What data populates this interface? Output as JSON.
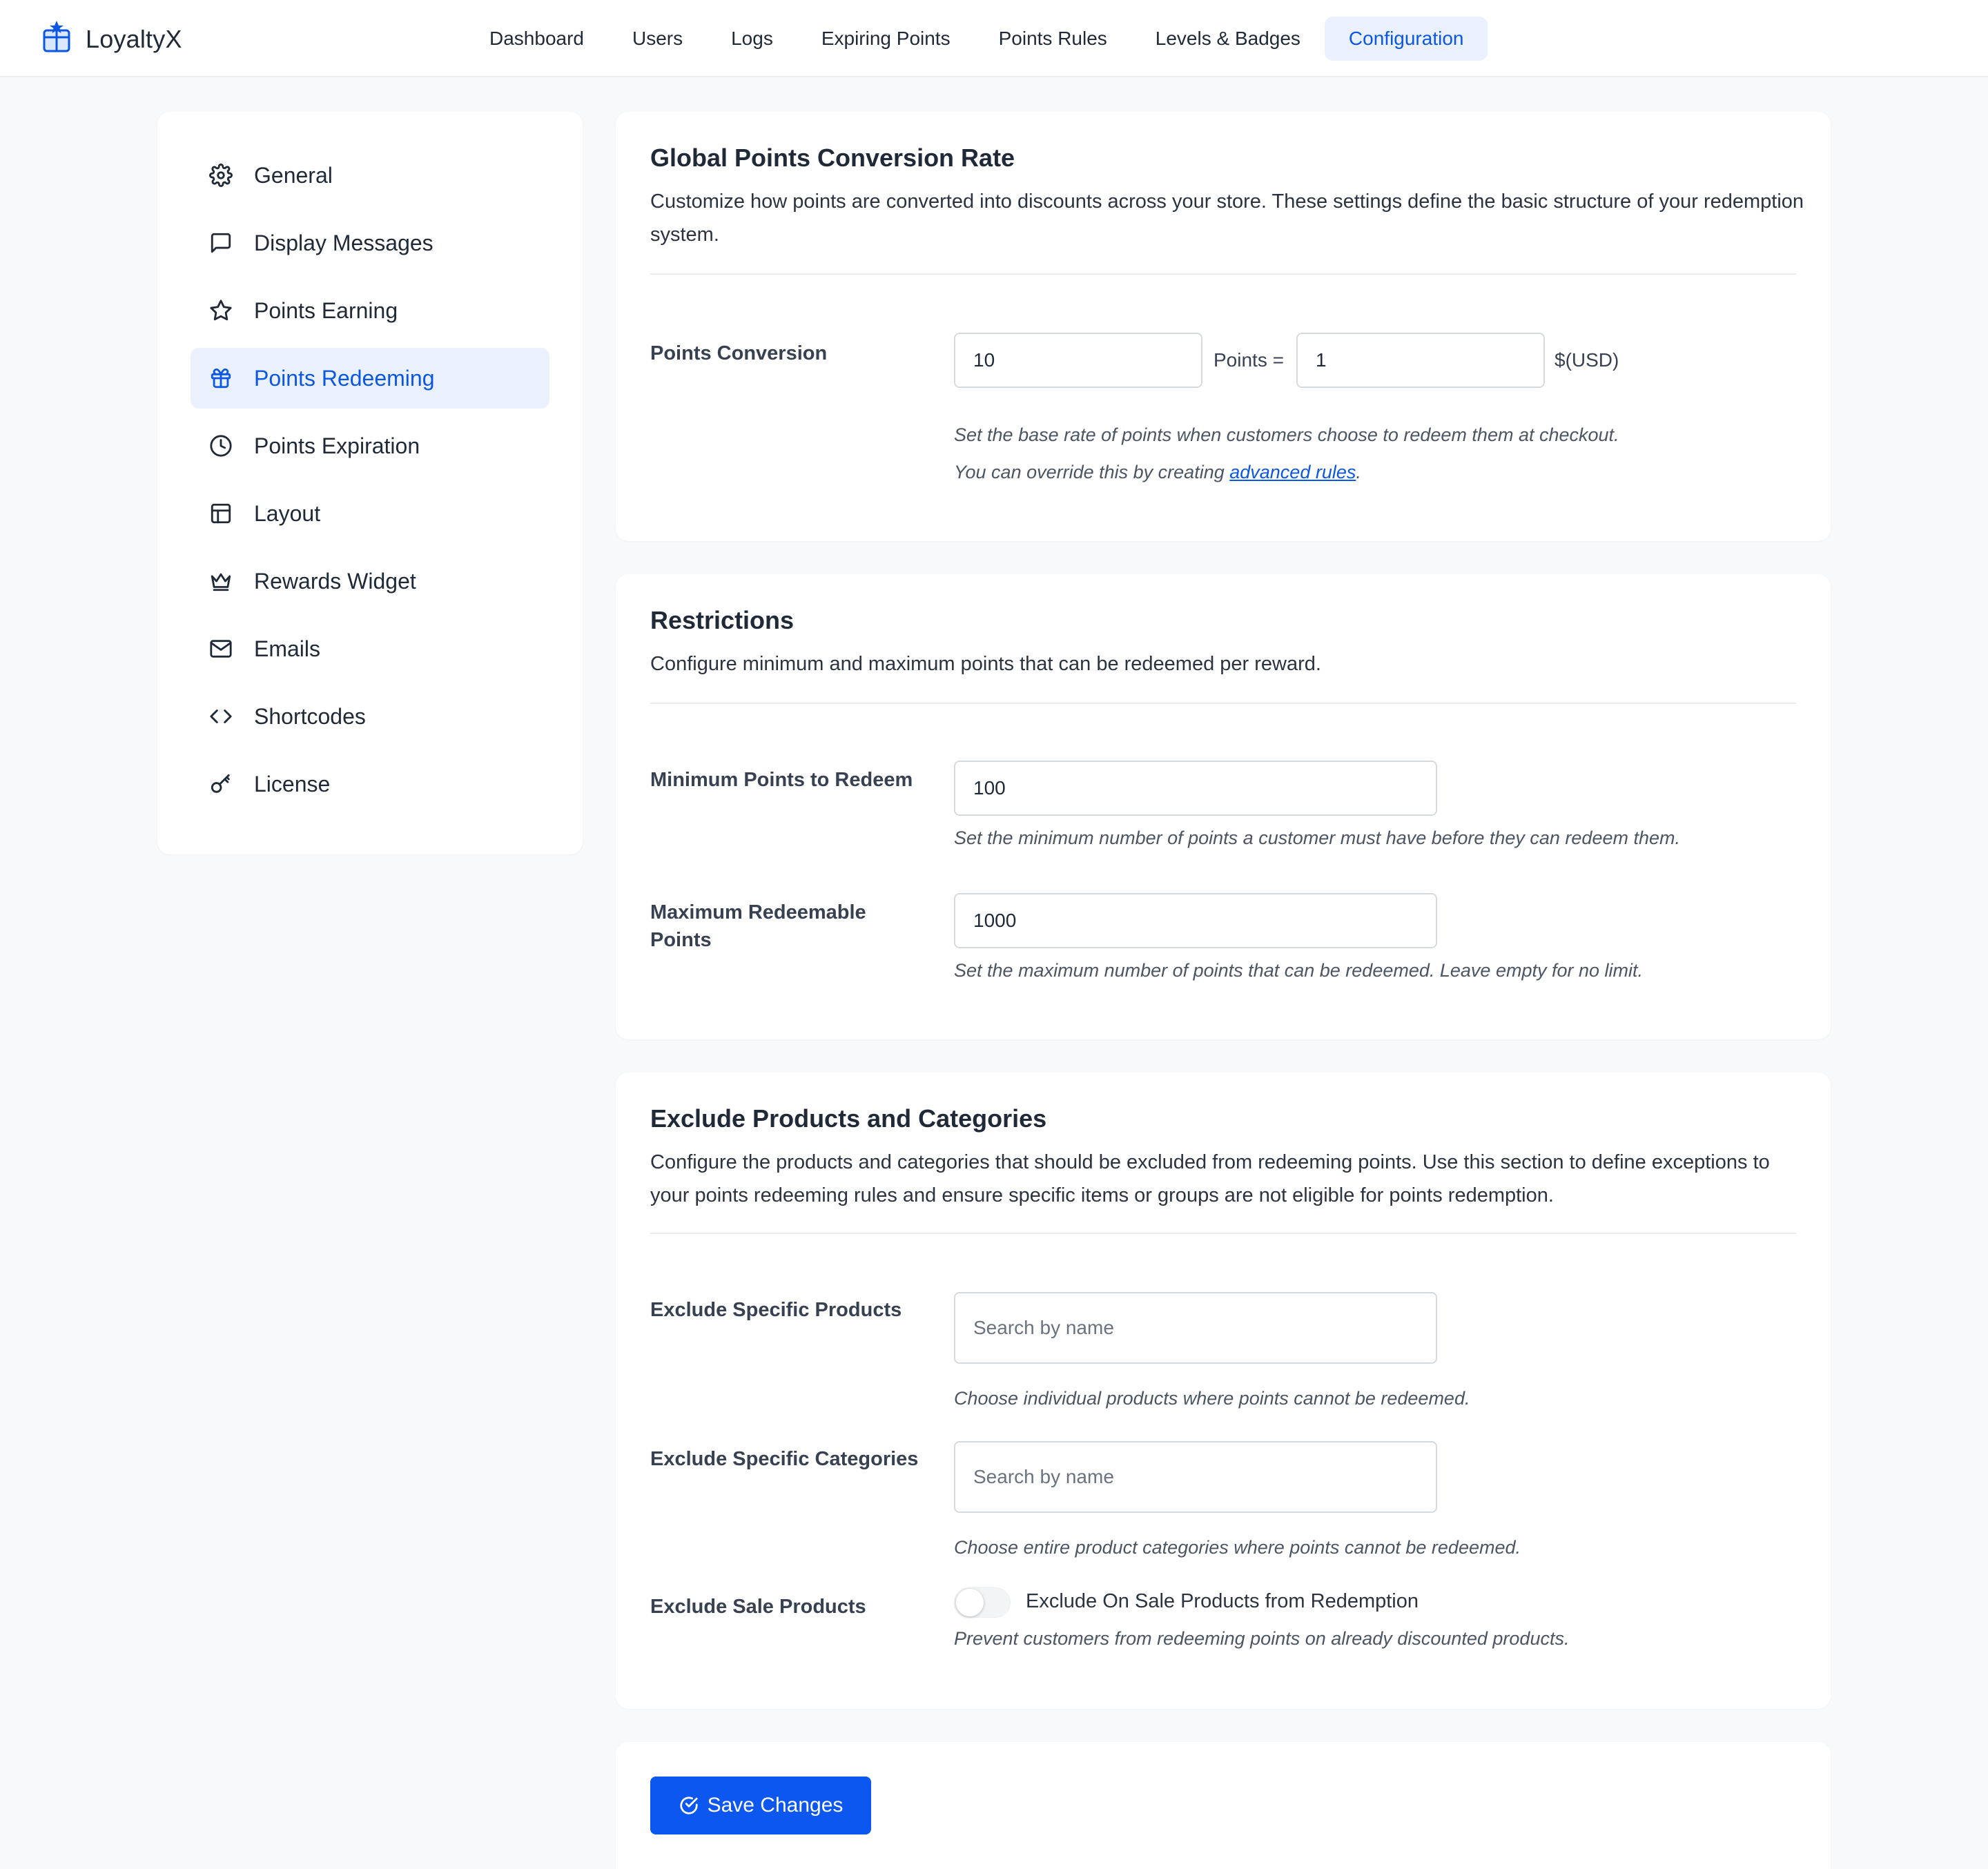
{
  "app": {
    "name": "LoyaltyX",
    "logo_icon": "gift-star-icon",
    "accent": "#0b57e3"
  },
  "nav": {
    "items": [
      {
        "label": "Dashboard"
      },
      {
        "label": "Users"
      },
      {
        "label": "Logs"
      },
      {
        "label": "Expiring Points"
      },
      {
        "label": "Points Rules"
      },
      {
        "label": "Levels & Badges"
      },
      {
        "label": "Configuration",
        "active": true
      }
    ]
  },
  "sidebar": {
    "items": [
      {
        "label": "General",
        "icon": "gear-icon"
      },
      {
        "label": "Display Messages",
        "icon": "message-icon"
      },
      {
        "label": "Points Earning",
        "icon": "star-icon"
      },
      {
        "label": "Points Redeeming",
        "icon": "gift-icon",
        "active": true
      },
      {
        "label": "Points Expiration",
        "icon": "clock-icon"
      },
      {
        "label": "Layout",
        "icon": "layout-icon"
      },
      {
        "label": "Rewards Widget",
        "icon": "crown-icon"
      },
      {
        "label": "Emails",
        "icon": "mail-icon"
      },
      {
        "label": "Shortcodes",
        "icon": "code-icon"
      },
      {
        "label": "License",
        "icon": "key-icon"
      }
    ]
  },
  "conversion": {
    "title": "Global Points Conversion Rate",
    "description": "Customize how points are converted into discounts across your store. These settings define the basic structure of your redemption system.",
    "field_label": "Points Conversion",
    "points_value": "10",
    "points_sep": "Points =",
    "money_value": "1",
    "currency": "$(USD)",
    "help_line1": "Set the base rate of points when customers choose to redeem them at checkout.",
    "help_line2_prefix": "You can override this by creating ",
    "help_link": "advanced rules",
    "help_line2_suffix": "."
  },
  "restrictions": {
    "title": "Restrictions",
    "description": "Configure minimum and maximum points that can be redeemed per reward.",
    "min_label": "Minimum Points to Redeem",
    "min_value": "100",
    "min_help": "Set the minimum number of points a customer must have before they can redeem them.",
    "max_label_line1": "Maximum Redeemable",
    "max_label_line2": "Points",
    "max_value": "1000",
    "max_help": "Set the maximum number of points that can be redeemed. Leave empty for no limit."
  },
  "exclude": {
    "title": "Exclude Products and Categories",
    "description": "Configure the products and categories that should be excluded from redeeming points. Use this section to define exceptions to your points redeeming rules and ensure specific items or groups are not eligible for points redemption.",
    "products_label": "Exclude Specific Products",
    "products_placeholder": "Search by name",
    "products_help": "Choose individual products where points cannot be redeemed.",
    "categories_label": "Exclude Specific Categories",
    "categories_placeholder": "Search by name",
    "categories_help": "Choose entire product categories where points cannot be redeemed.",
    "sale_label": "Exclude Sale Products",
    "sale_toggle_label": "Exclude On Sale Products from Redemption",
    "sale_toggle_on": false,
    "sale_help": "Prevent customers from redeeming points on already discounted products."
  },
  "actions": {
    "save_label": "Save Changes",
    "save_icon": "check-circle-icon"
  }
}
